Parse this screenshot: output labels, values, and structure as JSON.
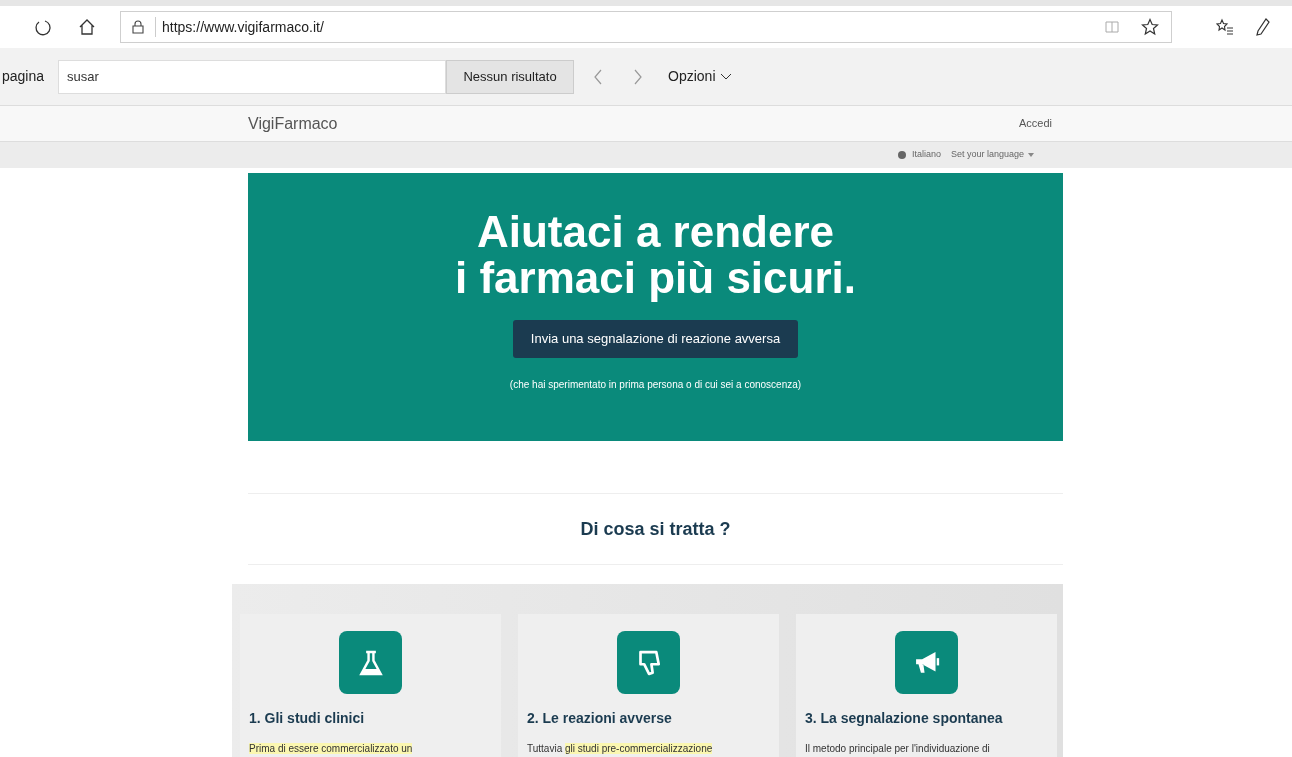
{
  "browser": {
    "url": "https://www.vigifarmaco.it/"
  },
  "find_bar": {
    "label": "pagina",
    "query": "susar",
    "result": "Nessun risultato",
    "options": "Opzioni"
  },
  "header": {
    "brand": "VigiFarmaco",
    "login": "Accedi"
  },
  "language_bar": {
    "current": "Italiano",
    "selector": "Set your language"
  },
  "hero": {
    "title_lines": [
      "Aiutaci a rendere",
      "i farmaci più sicuri."
    ],
    "button": "Invia una segnalazione di reazione avversa",
    "note": "(che hai sperimentato in prima persona o di cui sei a conoscenza)"
  },
  "section": {
    "title": "Di cosa si tratta ?"
  },
  "cards": [
    {
      "kind": "flask",
      "title": "1. Gli studi clinici",
      "text": [
        {
          "text": "Prima di essere commercializzato un",
          "highlighted": true
        }
      ]
    },
    {
      "kind": "thumbs-down",
      "title": "2. Le reazioni avverse",
      "text": [
        {
          "text": "Tuttavia ",
          "highlighted": false
        },
        {
          "text": "gli studi pre-commercializzazione",
          "highlighted": true
        }
      ]
    },
    {
      "kind": "megaphone",
      "title": "3. La segnalazione spontanea",
      "text": [
        {
          "text": "Il metodo principale per l'individuazione di",
          "highlighted": false
        }
      ]
    }
  ]
}
